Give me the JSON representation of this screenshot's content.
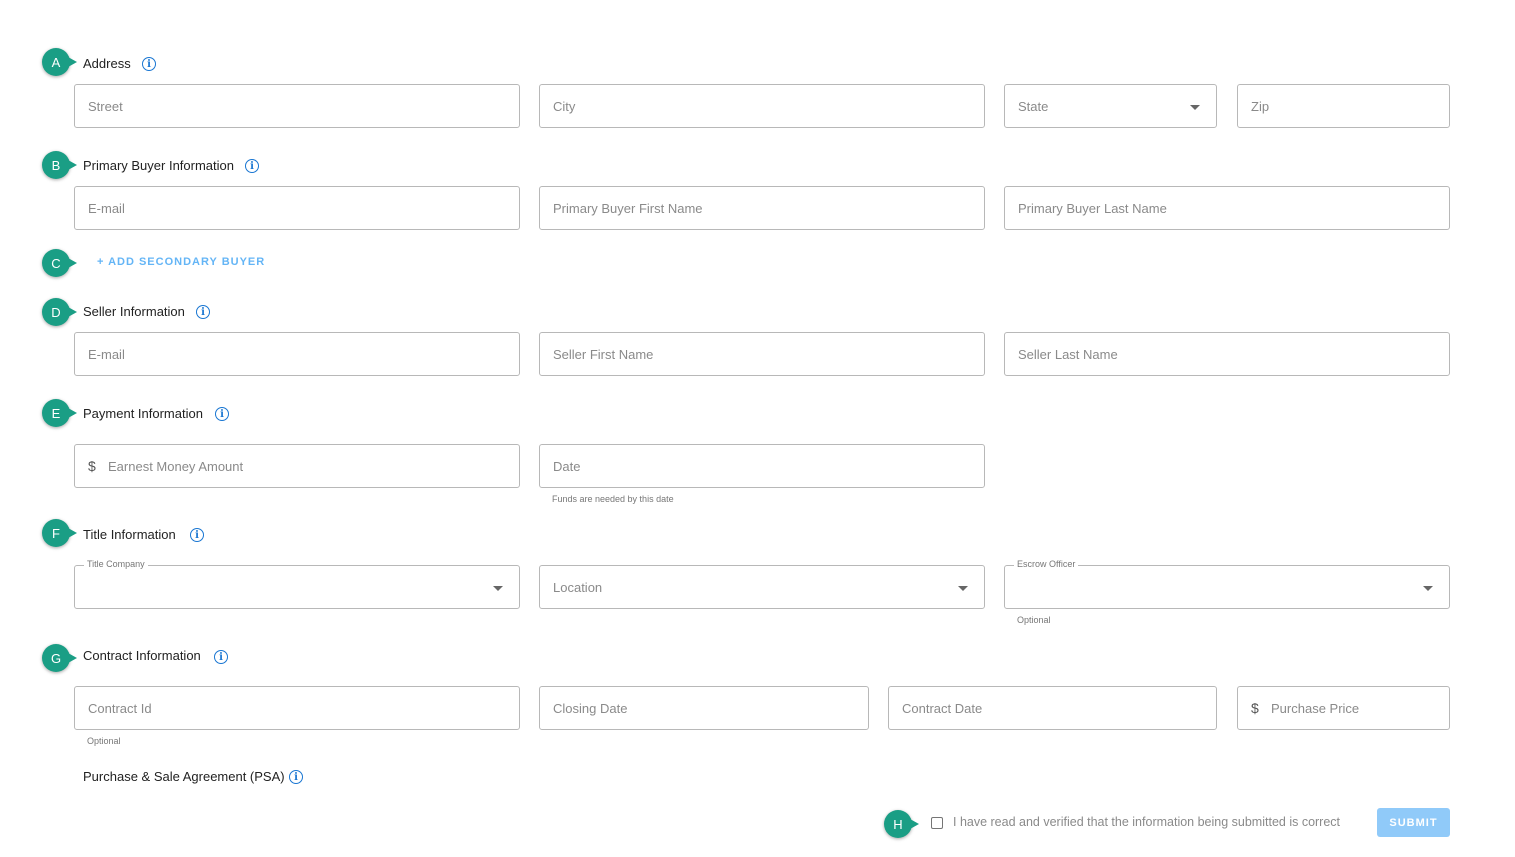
{
  "badges": [
    "A",
    "B",
    "C",
    "D",
    "E",
    "F",
    "G",
    "H"
  ],
  "address": {
    "label": "Address",
    "street_placeholder": "Street",
    "city_placeholder": "City",
    "state_placeholder": "State",
    "zip_placeholder": "Zip"
  },
  "primary_buyer": {
    "label": "Primary Buyer Information",
    "email_placeholder": "E-mail",
    "first_name_placeholder": "Primary Buyer First Name",
    "last_name_placeholder": "Primary Buyer Last Name"
  },
  "secondary_buyer": {
    "add_label": "+ ADD SECONDARY BUYER"
  },
  "seller": {
    "label": "Seller Information",
    "email_placeholder": "E-mail",
    "first_name_placeholder": "Seller First Name",
    "last_name_placeholder": "Seller Last Name"
  },
  "payment": {
    "label": "Payment Information",
    "currency_symbol": "$",
    "earnest_placeholder": "Earnest Money Amount",
    "date_placeholder": "Date",
    "date_helper": "Funds are needed by this date"
  },
  "title": {
    "label": "Title Information",
    "company_legend": "Title Company",
    "location_placeholder": "Location",
    "escrow_legend": "Escrow Officer",
    "escrow_helper": "Optional"
  },
  "contract": {
    "label": "Contract Information",
    "contract_id_placeholder": "Contract Id",
    "contract_id_helper": "Optional",
    "closing_date_placeholder": "Closing Date",
    "contract_date_placeholder": "Contract Date",
    "currency_symbol": "$",
    "purchase_price_placeholder": "Purchase Price"
  },
  "psa": {
    "label": "Purchase & Sale Agreement (PSA)"
  },
  "footer": {
    "verify_text": "I have read and verified that the information being submitted is correct",
    "submit_label": "SUBMIT"
  },
  "colors": {
    "badge": "#1a9e85",
    "info_icon": "#1976d2",
    "link": "#64b5f6",
    "submit": "#90caf9"
  },
  "icons": {
    "info": "info-icon",
    "dropdown": "chevron-down-icon",
    "currency": "dollar-icon"
  }
}
